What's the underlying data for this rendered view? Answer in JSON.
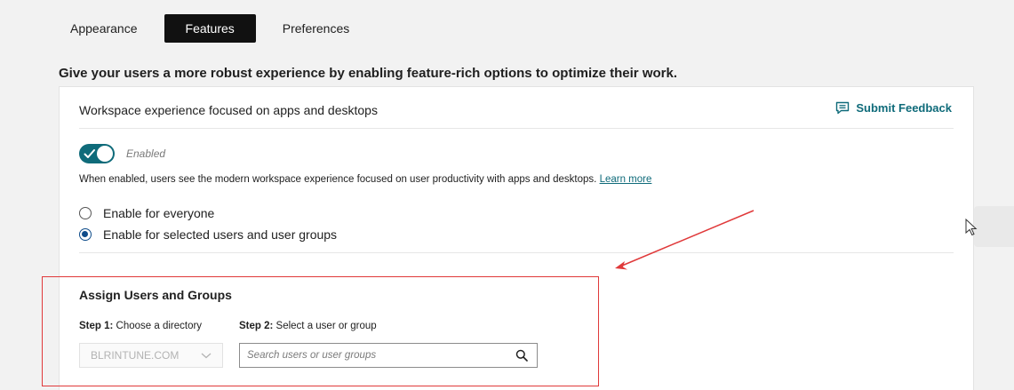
{
  "tabs": [
    {
      "label": "Appearance",
      "active": false
    },
    {
      "label": "Features",
      "active": true
    },
    {
      "label": "Preferences",
      "active": false
    }
  ],
  "intro": "Give your users a more robust experience by enabling feature-rich options to optimize their work.",
  "card": {
    "title": "Workspace experience focused on apps and desktops",
    "feedback_label": "Submit Feedback",
    "toggle": {
      "state": "on",
      "label": "Enabled"
    },
    "description": "When enabled, users see the modern workspace experience focused on user productivity with apps and desktops.",
    "learn_more": "Learn more",
    "radio_everyone": "Enable for everyone",
    "radio_selected": "Enable for selected users and user groups",
    "selected_option": "radio_selected"
  },
  "assign": {
    "title": "Assign Users and Groups",
    "step1_bold": "Step 1:",
    "step1_text": " Choose a directory",
    "step2_bold": "Step 2:",
    "step2_text": " Select a user or group",
    "directory_value": "BLRINTUNE.COM",
    "search_placeholder": "Search users or user groups"
  },
  "icons": {
    "feedback": "chat-icon",
    "toggle": "check-icon",
    "select": "chevron-down-icon",
    "search": "search-icon",
    "cursor": "mouse-pointer-icon"
  },
  "colors": {
    "accent": "#0f6b7a",
    "annotation": "#e0393a",
    "radio_selected": "#0f4c8a"
  }
}
